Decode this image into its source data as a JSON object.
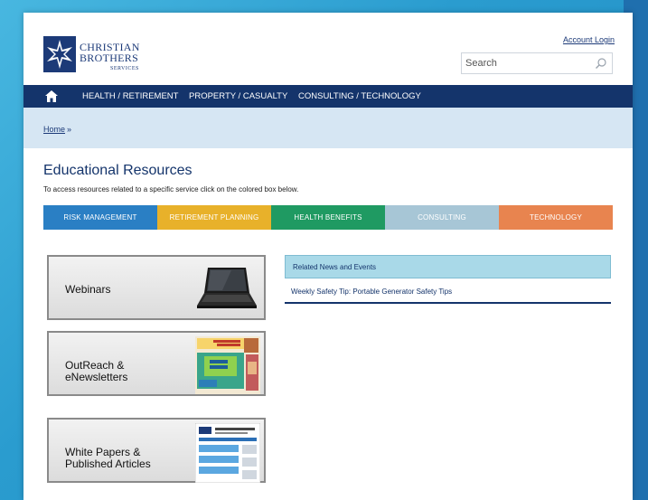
{
  "header": {
    "logo": {
      "line1": "CHRISTIAN",
      "line2": "BROTHERS",
      "line3": "SERVICES"
    },
    "account_login": "Account Login",
    "search": {
      "placeholder": "Search"
    }
  },
  "nav": {
    "home_icon": "home-icon",
    "items": [
      {
        "label": "HEALTH / RETIREMENT"
      },
      {
        "label": "PROPERTY / CASUALTY"
      },
      {
        "label": "CONSULTING / TECHNOLOGY"
      }
    ]
  },
  "breadcrumb": {
    "home": "Home",
    "separator": "»"
  },
  "main": {
    "title": "Educational Resources",
    "subtitle": "To access resources related to a specific service click on the colored box below."
  },
  "services": [
    {
      "label": "RISK MANAGEMENT",
      "color": "#2a7fc4"
    },
    {
      "label": "RETIREMENT PLANNING",
      "color": "#e8b12a"
    },
    {
      "label": "HEALTH BENEFITS",
      "color": "#1f9a62"
    },
    {
      "label": "CONSULTING",
      "color": "#a7c6d6"
    },
    {
      "label": "TECHNOLOGY",
      "color": "#e8844f"
    }
  ],
  "resources": [
    {
      "label": "Webinars"
    },
    {
      "label": "OutReach & eNewsletters"
    },
    {
      "label": "White Papers & Published Articles"
    }
  ],
  "news": {
    "heading": "Related News and Events",
    "items": [
      {
        "label": "Weekly Safety Tip: Portable Generator Safety Tips"
      }
    ]
  },
  "colors": {
    "navy": "#14346b",
    "crumb_bg": "#d6e6f3",
    "news_bg": "#a9d9e8"
  }
}
